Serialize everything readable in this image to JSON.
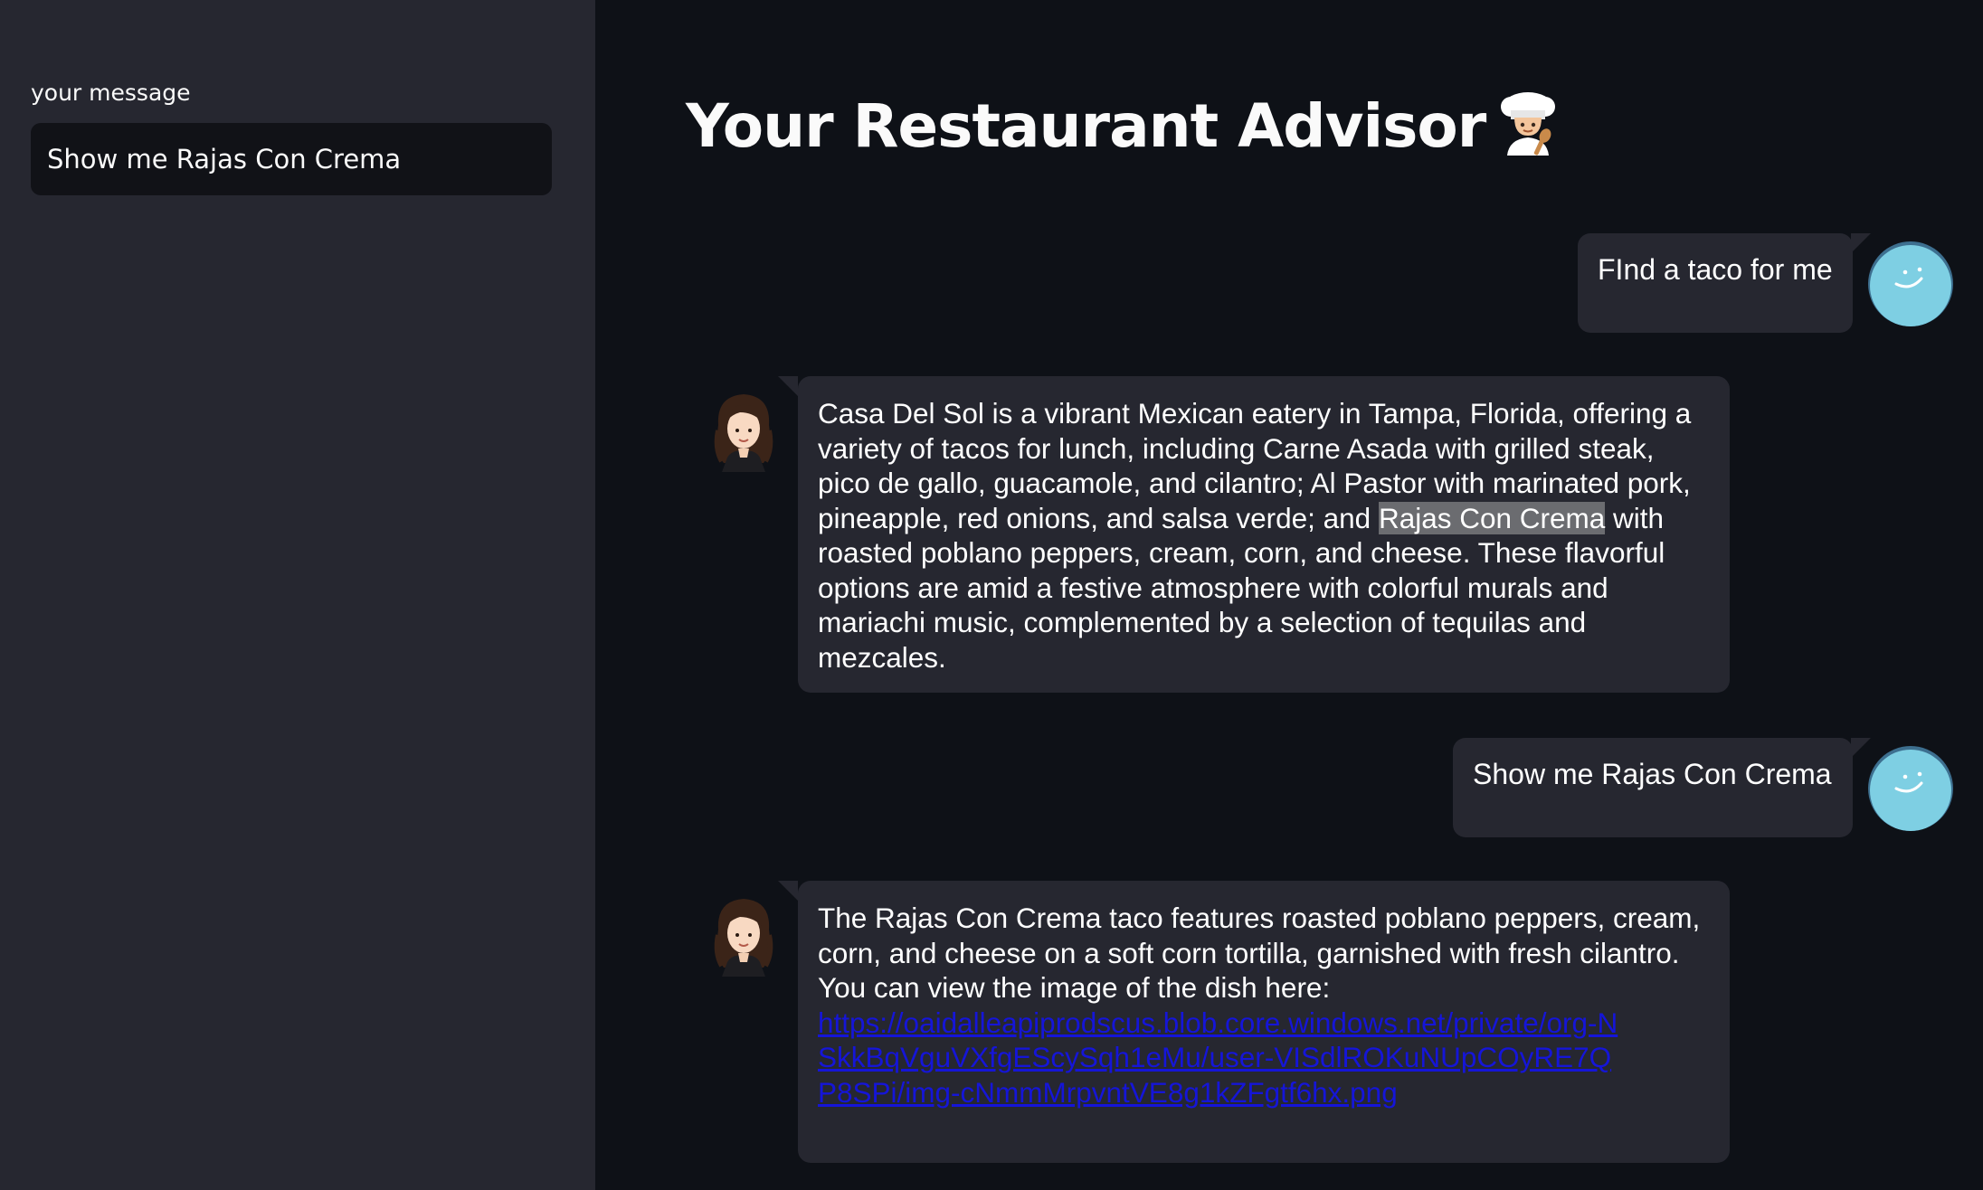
{
  "sidebar": {
    "label": "your message",
    "input_value": "Show me Rajas Con Crema"
  },
  "main": {
    "title": "Your Restaurant Advisor",
    "title_icon": "chef-icon"
  },
  "messages": [
    {
      "role": "user",
      "avatar": "smiley-bot-avatar",
      "text": "FInd a taco for me"
    },
    {
      "role": "assistant",
      "avatar": "woman-avatar",
      "text_before": "Casa Del Sol is a vibrant Mexican eatery in Tampa, Florida, offering a variety of tacos for lunch, including Carne Asada with grilled steak, pico de gallo, guacamole, and cilantro; Al Pastor with marinated pork, pineapple, red onions, and salsa verde; and ",
      "highlight": "Rajas Con Crema",
      "text_after": " with roasted poblano peppers, cream, corn, and cheese. These flavorful options are amid a festive atmosphere with colorful murals and mariachi music, complemented by a selection of tequilas and mezcales."
    },
    {
      "role": "user",
      "avatar": "smiley-bot-avatar",
      "text": "Show me Rajas Con Crema"
    },
    {
      "role": "assistant",
      "avatar": "woman-avatar",
      "text": "The Rajas Con Crema taco features roasted poblano peppers, cream, corn, and cheese on a soft corn tortilla, garnished with fresh cilantro. You can view the image of the dish here: ",
      "link": "https://oaidalleapiprodscus.blob.core.windows.net/private/org-NSkkBqVguVXfgEScySqh1eMu/user-VISdlROKuNUpCOyRE7QP8SPi/img-cNmmMrpvntVE8g1kZFgtf6hx.png"
    }
  ],
  "colors": {
    "sidebar_bg": "#262730",
    "main_bg": "#0e1117",
    "bubble_bg": "#262730",
    "link": "#1515d8",
    "highlight": "#6b6c70",
    "user_avatar": "#7ecfe3"
  }
}
